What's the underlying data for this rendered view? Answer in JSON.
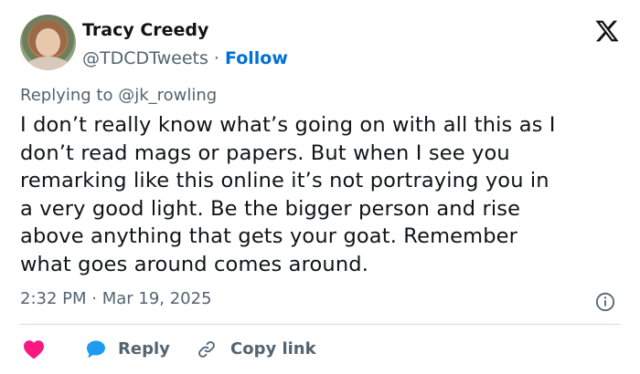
{
  "author": {
    "name": "Tracy Creedy",
    "handle": "@TDCDTweets",
    "separator": "·",
    "follow_label": "Follow"
  },
  "replying_to": "Replying to @jk_rowling",
  "tweet": {
    "lines": [
      "I don’t really know what’s going on with all this as I",
      "don’t read mags or papers. But when I see you",
      "remarking like this online it’s not portraying you in",
      "a very good light. Be the bigger person and rise",
      "above anything that gets your goat. Remember",
      "what goes around comes around."
    ]
  },
  "timestamp": "2:32 PM · Mar 19, 2025",
  "actions": {
    "reply_label": "Reply",
    "copy_link_label": "Copy link"
  },
  "icons": {
    "logo": "x-logo-icon",
    "info": "info-icon",
    "like": "heart-icon",
    "reply": "speech-bubble-icon",
    "copy": "link-icon"
  },
  "colors": {
    "like": "#f91880",
    "reply": "#1d9bf0",
    "follow": "#006fd6",
    "secondary_text": "#536471"
  }
}
